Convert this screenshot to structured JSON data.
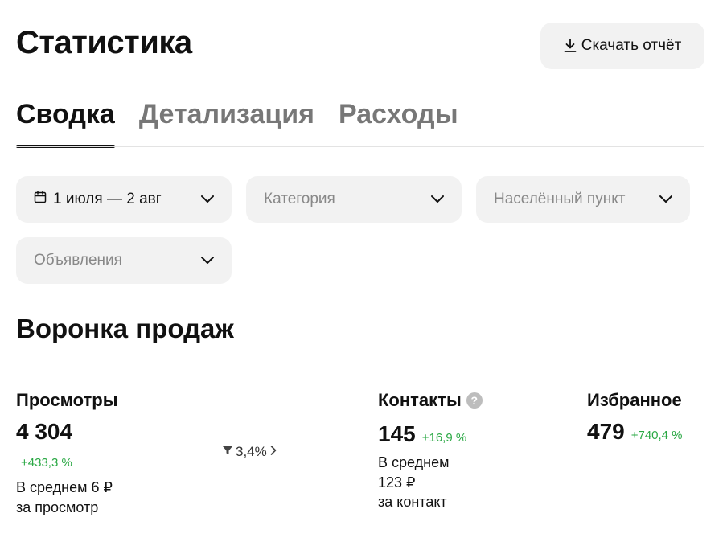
{
  "header": {
    "title": "Статистика",
    "download_label": "Скачать отчёт",
    "download_icon": "download-icon"
  },
  "tabs": [
    {
      "label": "Сводка",
      "active": true
    },
    {
      "label": "Детализация",
      "active": false
    },
    {
      "label": "Расходы",
      "active": false
    }
  ],
  "filters": {
    "date": {
      "value": "1 июля — 2 авг",
      "icon": "calendar-icon"
    },
    "category": {
      "placeholder": "Категория"
    },
    "city": {
      "placeholder": "Населённый пункт"
    },
    "ads": {
      "placeholder": "Объявления"
    }
  },
  "funnel": {
    "title": "Воронка продаж",
    "views": {
      "label": "Просмотры",
      "value": "4 304",
      "delta": "+433,3 %",
      "note_line1": "В среднем 6 ₽",
      "note_line2": "за просмотр"
    },
    "conversion": {
      "value": "3,4%",
      "icon": "funnel-icon"
    },
    "contacts": {
      "label": "Контакты",
      "value": "145",
      "delta": "+16,9 %",
      "note_line1": "В среднем",
      "note_line2": "123 ₽",
      "note_line3": "за контакт"
    },
    "favorites": {
      "label": "Избранное",
      "value": "479",
      "delta": "+740,4 %"
    }
  },
  "colors": {
    "accent_positive": "#2aa844",
    "chip_bg": "#f2f2f2",
    "text_primary": "#111111",
    "text_muted": "#888888"
  }
}
